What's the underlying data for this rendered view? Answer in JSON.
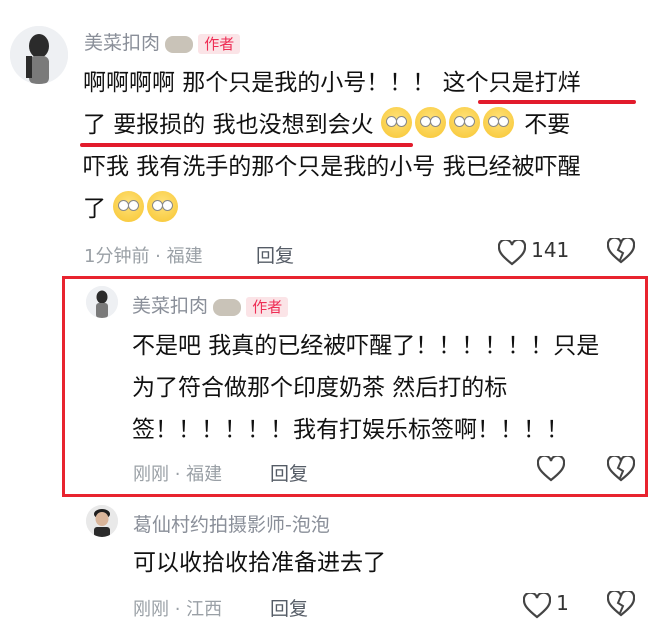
{
  "comment1": {
    "username": "美菜扣肉",
    "author_badge": "作者",
    "lines": [
      "啊啊啊啊 那个只是我的小号！！！ 这个只是打烊",
      "了 要报损的 我也没想到会火",
      "吓我 我有洗手的那个只是我的小号 我已经被吓醒",
      "了"
    ],
    "line2_suffix": "不要",
    "meta": "1分钟前 · 福建",
    "reply_label": "回复",
    "like_count": "141"
  },
  "comment2": {
    "username": "美菜扣肉",
    "author_badge": "作者",
    "lines": [
      "不是吧 我真的已经被吓醒了！！！！！！只是",
      "为了符合做那个印度奶茶 然后打的标",
      "签！！！！！！我有打娱乐标签啊！！！！"
    ],
    "meta": "刚刚 · 福建",
    "reply_label": "回复"
  },
  "comment3": {
    "username": "葛仙村约拍摄影师-泡泡",
    "lines": [
      "可以收拾收拾准备进去了"
    ],
    "meta": "刚刚 · 江西",
    "reply_label": "回复",
    "like_count": "1"
  },
  "icons": {
    "like": "heart-outline-icon",
    "dislike": "broken-heart-icon",
    "emoji": "flushed-face-emoji"
  },
  "colors": {
    "highlight": "#e21b2c",
    "author_badge": "#ee2e55"
  }
}
